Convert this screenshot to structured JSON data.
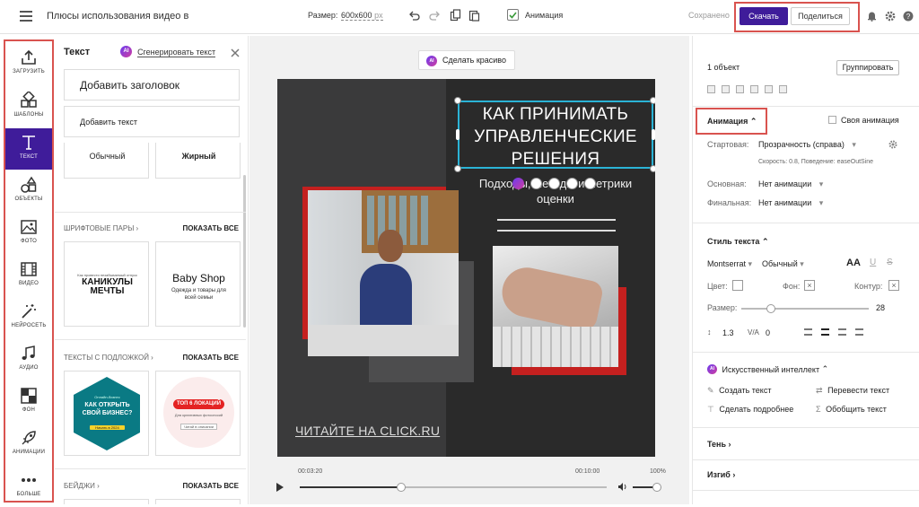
{
  "header": {
    "title": "Плюсы использования видео в",
    "size_label": "Размер:",
    "size_value": "600x600",
    "size_unit": "px",
    "animation_label": "Анимация",
    "saved_label": "Сохранено",
    "download_label": "Скачать",
    "share_label": "Поделиться"
  },
  "tools": [
    {
      "label": "ЗАГРУЗИТЬ",
      "icon": "upload-icon"
    },
    {
      "label": "ШАБЛОНЫ",
      "icon": "templates-icon"
    },
    {
      "label": "ТЕКСТ",
      "icon": "text-icon"
    },
    {
      "label": "ОБЪЕКТЫ",
      "icon": "shapes-icon"
    },
    {
      "label": "ФОТО",
      "icon": "photo-icon"
    },
    {
      "label": "ВИДЕО",
      "icon": "film-icon"
    },
    {
      "label": "НЕЙРОСЕТЬ",
      "icon": "magic-wand-icon"
    },
    {
      "label": "АУДИО",
      "icon": "music-note-icon"
    },
    {
      "label": "ФОН",
      "icon": "background-icon"
    },
    {
      "label": "АНИМАЦИИ",
      "icon": "rocket-icon"
    },
    {
      "label": "БОЛЬШЕ",
      "icon": "more-icon"
    }
  ],
  "panel": {
    "title": "Текст",
    "ai_badge": "AI",
    "generate_label": "Сгенерировать текст",
    "add_heading": "Добавить заголовок",
    "add_text": "Добавить текст",
    "style_normal": "Обычный",
    "style_bold": "Жирный",
    "font_pairs_label": "ШРИФТОВЫЕ ПАРЫ",
    "show_all": "ПОКАЗАТЬ ВСЕ",
    "pair1_small": "Как провести незабываемый отпуск",
    "pair1_main": "КАНИКУЛЫ МЕЧТЫ",
    "pair2_main": "Baby Shop",
    "pair2_sub": "Одежда и товары для всей семьи",
    "bg_texts_label": "ТЕКСТЫ С ПОДЛОЖКОЙ",
    "badge1_small": "Онлайн-бизнес",
    "badge1_main": "КАК ОТКРЫТЬ СВОЙ БИЗНЕС?",
    "badge1_btn": "Начать в 2024",
    "badge2_main": "ТОП 6 ЛОКАЦИЙ",
    "badge2_sub": "Для креативных фотосессий",
    "badge2_btn": "Читай в описании",
    "badges_label": "БЕЙДЖИ"
  },
  "workspace": {
    "beautify_label": "Сделать красиво",
    "ai_badge": "AI",
    "title_text": "КАК ПРИНИМАТЬ УПРАВЛЕНЧЕСКИЕ РЕШЕНИЯ",
    "subtitle_text": "Подходы, методы и метрики оценки",
    "footer_text": "ЧИТАЙТЕ НА CLICK.RU",
    "time_current": "00:03:20",
    "time_total": "00:10:00",
    "zoom": "100%",
    "progress": 0.33,
    "volume": 0.85
  },
  "right": {
    "objects_count": "1 объект",
    "group_label": "Группировать",
    "animation_section": "Анимация",
    "own_animation": "Своя анимация",
    "start_label": "Стартовая:",
    "start_value": "Прозрачность (справа)",
    "speed_info": "Скорость: 0.8, Поведение: easeOutSine",
    "main_label": "Основная:",
    "main_value": "Нет анимации",
    "final_label": "Финальная:",
    "final_value": "Нет анимации",
    "text_style": "Стиль текста",
    "font": "Montserrat",
    "weight": "Обычный",
    "aa": "AA",
    "color_label": "Цвет:",
    "bg_label": "Фон:",
    "outline_label": "Контур:",
    "size_label": "Размер:",
    "size_value": "28",
    "size_fraction": 0.23,
    "line_height": "1.3",
    "spacing": "0",
    "va": "V/A",
    "ai_section": "Искусственный интеллект",
    "ai_badge": "AI",
    "create_text": "Создать текст",
    "translate_text": "Перевести текст",
    "detail_text": "Сделать подробнее",
    "summarize_text": "Обобщить текст",
    "shadow": "Тень",
    "bend": "Изгиб"
  },
  "colors": {
    "accent": "#3f1c9a",
    "highlight": "#d9534f",
    "canvas_dark": "#323232",
    "canvas_darker": "#2a2a2a",
    "red": "#c4201f"
  }
}
